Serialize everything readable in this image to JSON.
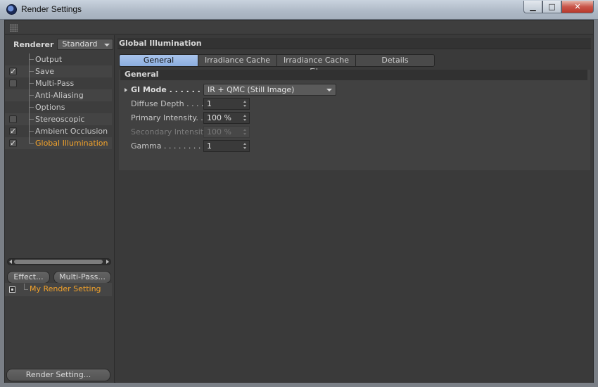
{
  "window": {
    "title": "Render Settings",
    "minimize_label": "▁",
    "maximize_label": "□",
    "close_label": "✕"
  },
  "left_panel": {
    "renderer_label": "Renderer",
    "renderer_value": "Standard",
    "tree": [
      {
        "label": "Output",
        "checkbox": false,
        "checked": false,
        "active": false
      },
      {
        "label": "Save",
        "checkbox": true,
        "checked": true,
        "active": false
      },
      {
        "label": "Multi-Pass",
        "checkbox": true,
        "checked": false,
        "active": false
      },
      {
        "label": "Anti-Aliasing",
        "checkbox": false,
        "checked": false,
        "active": false
      },
      {
        "label": "Options",
        "checkbox": false,
        "checked": false,
        "active": false
      },
      {
        "label": "Stereoscopic",
        "checkbox": true,
        "checked": false,
        "active": false
      },
      {
        "label": "Ambient Occlusion",
        "checkbox": true,
        "checked": true,
        "active": false
      },
      {
        "label": "Global Illumination",
        "checkbox": true,
        "checked": true,
        "active": true
      }
    ],
    "effect_button": "Effect...",
    "multipass_button": "Multi-Pass...",
    "render_setting_name": "My Render Setting",
    "render_setting_button": "Render Setting..."
  },
  "right_panel": {
    "section_title": "Global Illumination",
    "tabs": [
      {
        "label": "General",
        "active": true
      },
      {
        "label": "Irradiance Cache",
        "active": false
      },
      {
        "label": "Irradiance Cache File",
        "active": false
      },
      {
        "label": "Details",
        "active": false
      }
    ],
    "group_title": "General",
    "gi_mode_label": "GI Mode . . . . . . . . .",
    "gi_mode_value": "IR + QMC (Still Image)",
    "diffuse_depth_label": "Diffuse Depth . . . . .",
    "diffuse_depth_value": "1",
    "primary_intensity_label": "Primary Intensity. . .",
    "primary_intensity_value": "100 %",
    "secondary_intensity_label": "Secondary Intensity",
    "secondary_intensity_value": "100 %",
    "gamma_label": "Gamma . . . . . . . . . . .",
    "gamma_value": "1"
  },
  "colors": {
    "accent_orange": "#f3a32b",
    "active_tab_blue": "#8caedf",
    "panel_bg": "#3a3a3a"
  }
}
